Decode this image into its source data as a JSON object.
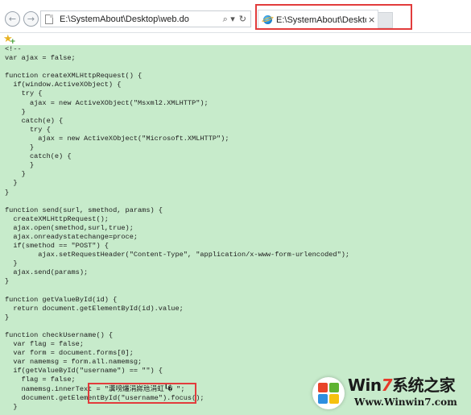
{
  "browser": {
    "address": "E:\\SystemAbout\\Desktop\\web.do",
    "search_icon": "⌕ ▾",
    "refresh_icon": "↻",
    "tab_title": "E:\\SystemAbout\\Desktop...",
    "tab_close": "×"
  },
  "code_lines": [
    "<!--",
    "var ajax = false;",
    "",
    "function createXMLHttpRequest() {",
    "  if(window.ActiveXObject) {",
    "    try {",
    "      ajax = new ActiveXObject(\"Msxml2.XMLHTTP\");",
    "    }",
    "    catch(e) {",
    "      try {",
    "        ajax = new ActiveXObject(\"Microsoft.XMLHTTP\");",
    "      }",
    "      catch(e) {",
    "      }",
    "    }",
    "  }",
    "}",
    "",
    "function send(surl, smethod, params) {",
    "  createXMLHttpRequest();",
    "  ajax.open(smethod,surl,true);",
    "  ajax.onreadystatechange=proce;",
    "  if(smethod == \"POST\") {",
    "        ajax.setRequestHeader(\"Content-Type\", \"application/x-www-form-urlencoded\");",
    "  }",
    "  ajax.send(params);",
    "}",
    "",
    "function getValueById(id) {",
    "  return document.getElementById(id).value;",
    "}",
    "",
    "function checkUsername() {",
    "  var flag = false;",
    "  var form = document.forms[0];",
    "  var namemsg = form.all.namemsg;",
    "  if(getValueById(\"username\") == \"\") {",
    "    flag = false;",
    "    namemsg.innerText = \"瀵嗙爜涓嶈兘涓虹┖� \";",
    "    document.getElementById(\"username\").focus();",
    "  }"
  ],
  "watermark": {
    "brand_prefix": "Win",
    "brand_seven": "7",
    "brand_suffix": "系统之家",
    "url": "Www.Winwin7.com"
  },
  "colors": {
    "content_bg": "#c7ebcb",
    "highlight_box": "#e23c3c"
  }
}
